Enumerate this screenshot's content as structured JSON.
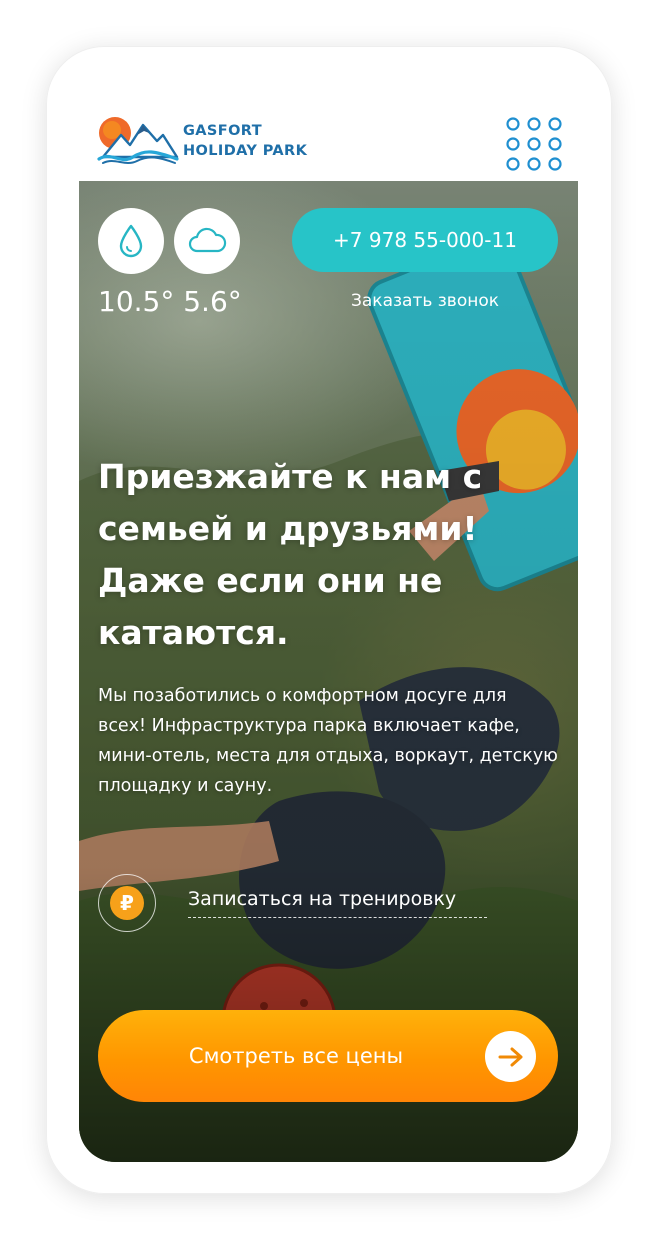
{
  "brand": {
    "line1": "GASFORT",
    "line2": "HOLIDAY PARK"
  },
  "weather": {
    "temperatures": "10.5° 5.6°"
  },
  "contact": {
    "phone": "+7 978 55-000-11",
    "callback": "Заказать звонок"
  },
  "hero": {
    "headline": "Приезжайте к нам с семьей и друзьями! Даже если они не катаются.",
    "description": "Мы позаботились о комфортном досуге для всех! Инфраструктура парка включает кафе, мини-отель, места для отдыха, воркаут, детскую площадку и сауну.",
    "ruble_symbol": "₽",
    "signup": "Записаться на тренировку",
    "prices_button": "Смотреть все цены"
  },
  "icons": {
    "logo": "mountain-sun-logo-icon",
    "menu": "grid-dots-menu-icon",
    "humidity": "droplet-icon",
    "cloud": "cloud-icon",
    "ruble": "ruble-icon",
    "arrow": "arrow-right-icon"
  },
  "colors": {
    "brand_blue": "#1f6fa8",
    "teal": "#27c4c8",
    "orange": "#ff9600",
    "ruble_orange": "#f7a11a"
  }
}
